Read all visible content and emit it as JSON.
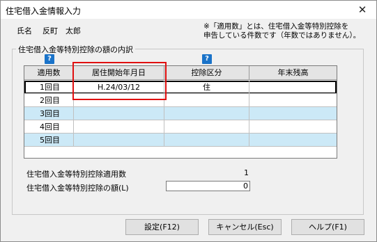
{
  "window": {
    "title": "住宅借入金情報入力",
    "close_glyph": "✕"
  },
  "person": {
    "label": "氏名",
    "value": "反町　太郎"
  },
  "note": {
    "line1": "※「適用数」とは、住宅借入金等特別控除を",
    "line2": "申告している件数です（年数ではありません）。"
  },
  "group": {
    "legend": "住宅借入金等特別控除の額の内訳"
  },
  "help_icon": "?",
  "table": {
    "headers": [
      "適用数",
      "居住開始年月日",
      "控除区分",
      "年末残高"
    ],
    "rows": [
      {
        "label": "1回目",
        "date": "H.24/03/12",
        "category": "住",
        "balance": ""
      },
      {
        "label": "2回目",
        "date": "",
        "category": "",
        "balance": ""
      },
      {
        "label": "3回目",
        "date": "",
        "category": "",
        "balance": ""
      },
      {
        "label": "4回目",
        "date": "",
        "category": "",
        "balance": ""
      },
      {
        "label": "5回目",
        "date": "",
        "category": "",
        "balance": ""
      }
    ]
  },
  "summary": {
    "count_label": "住宅借入金等特別控除適用数",
    "count_value": "1",
    "amount_label": "住宅借入金等特別控除の額(L)",
    "amount_value": "0"
  },
  "buttons": {
    "ok": "設定(F12)",
    "cancel": "キャンセル(Esc)",
    "help": "ヘルプ(F1)"
  },
  "colors": {
    "row_alt": "#cce9f7",
    "header_bg": "#e4e4e4",
    "annotation": "#e01010",
    "help_icon": "#1a73c9"
  }
}
